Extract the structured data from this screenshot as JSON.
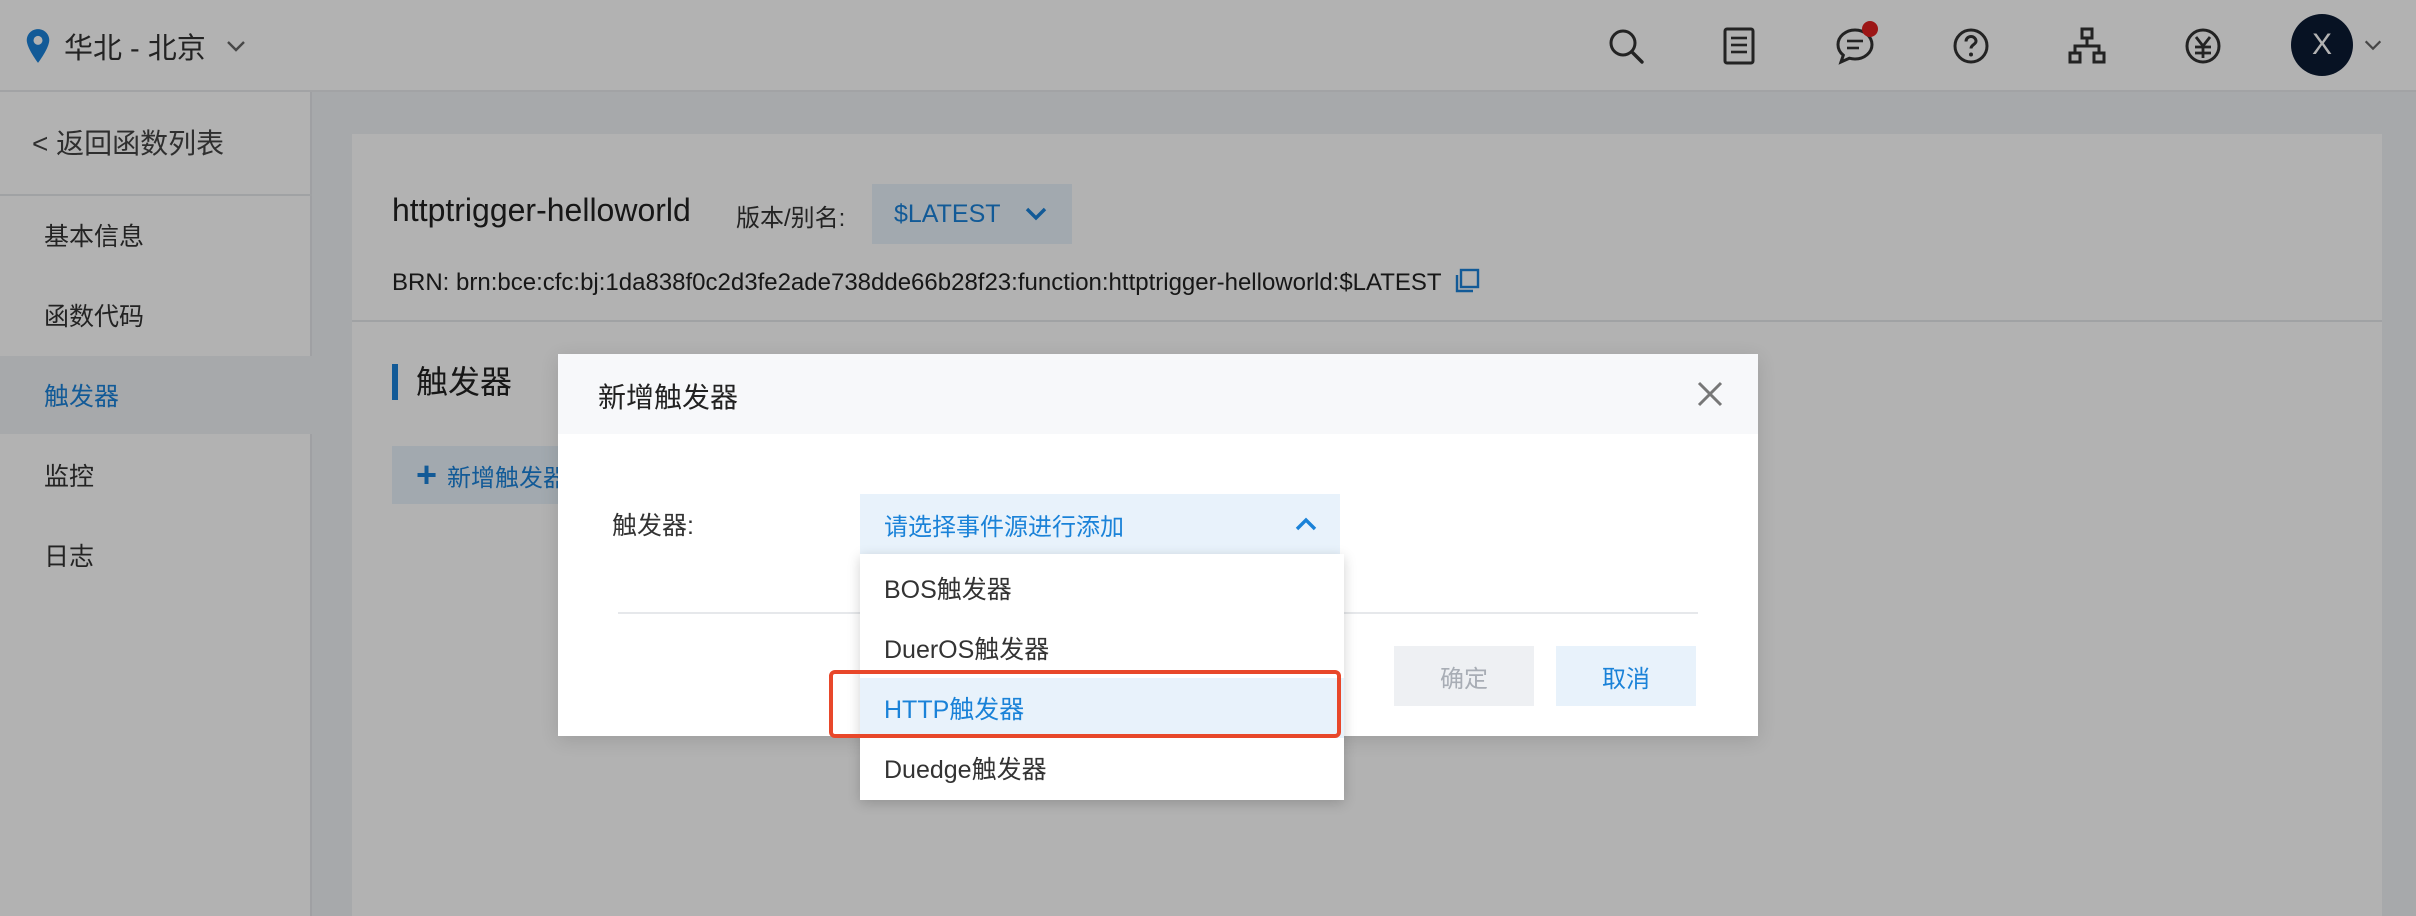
{
  "header": {
    "region": "华北 - 北京",
    "icons": [
      "search-icon",
      "document-list-icon",
      "message-icon",
      "help-icon",
      "org-structure-icon",
      "billing-icon"
    ],
    "avatar_letter": "X",
    "notification_color": "#e02020"
  },
  "sidebar": {
    "back_label": "< 返回函数列表",
    "items": [
      {
        "label": "基本信息"
      },
      {
        "label": "函数代码"
      },
      {
        "label": "触发器",
        "active": true
      },
      {
        "label": "监控"
      },
      {
        "label": "日志"
      }
    ]
  },
  "main": {
    "function_name": "httptrigger-helloworld",
    "version_label": "版本/别名:",
    "version_value": "$LATEST",
    "brn_label": "BRN:",
    "brn_value": "brn:bce:cfc:bj:1da838f0c2d3fe2ade738dde66b28f23:function:httptrigger-helloworld:$LATEST",
    "section_title": "触发器",
    "add_button_label": "新增触发器"
  },
  "modal": {
    "title": "新增触发器",
    "field_label": "触发器:",
    "select_placeholder": "请选择事件源进行添加",
    "options": [
      "BOS触发器",
      "DuerOS触发器",
      "HTTP触发器",
      "Duedge触发器"
    ],
    "highlighted_option": "HTTP触发器",
    "ok_label": "确定",
    "cancel_label": "取消"
  },
  "colors": {
    "accent": "#1a82d8",
    "highlight_border": "#e8472a",
    "avatar_bg": "#0b1a33"
  }
}
